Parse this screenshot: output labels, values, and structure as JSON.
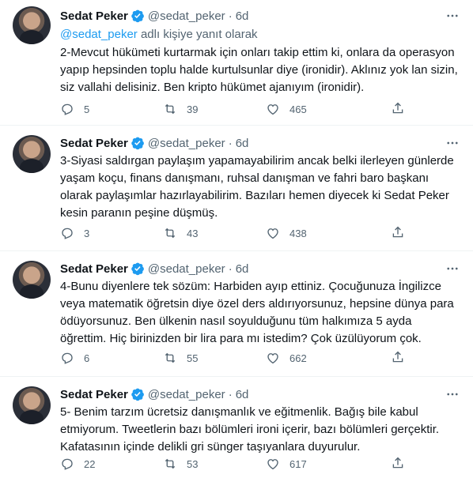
{
  "tweets": [
    {
      "name": "Sedat Peker",
      "handle": "@sedat_peker",
      "time": "6d",
      "reply_mention": "@sedat_peker",
      "reply_suffix": " adlı kişiye yanıt olarak",
      "text": "2-Mevcut hükümeti kurtarmak için onları takip ettim ki, onlara da operasyon yapıp hepsinden toplu halde kurtulsunlar diye (ironidir). Aklınız yok lan sizin, siz vallahi delisiniz. Ben kripto hükümet ajanıyım (ironidir).",
      "replies": "5",
      "retweets": "39",
      "likes": "465"
    },
    {
      "name": "Sedat Peker",
      "handle": "@sedat_peker",
      "time": "6d",
      "text": "3-Siyasi saldırgan paylaşım yapamayabilirim ancak belki ilerleyen günlerde yaşam koçu, finans danışmanı, ruhsal danışman ve fahri baro başkanı olarak paylaşımlar hazırlayabilirim. Bazıları hemen diyecek ki Sedat Peker kesin paranın peşine düşmüş.",
      "replies": "3",
      "retweets": "43",
      "likes": "438"
    },
    {
      "name": "Sedat Peker",
      "handle": "@sedat_peker",
      "time": "6d",
      "text": "4-Bunu diyenlere tek sözüm: Harbiden ayıp ettiniz. Çocuğunuza İngilizce veya matematik öğretsin diye özel ders aldırıyorsunuz, hepsine dünya para ödüyorsunuz. Ben ülkenin nasıl soyulduğunu tüm halkımıza 5 ayda öğrettim. Hiç birinizden bir lira para mı istedim? Çok üzülüyorum çok.",
      "replies": "6",
      "retweets": "55",
      "likes": "662"
    },
    {
      "name": "Sedat Peker",
      "handle": "@sedat_peker",
      "time": "6d",
      "text": "5- Benim tarzım ücretsiz danışmanlık ve eğitmenlik. Bağış bile kabul etmiyorum. Tweetlerin bazı bölümleri ironi içerir, bazı bölümleri gerçektir. Kafatasının içinde delikli gri sünger taşıyanlara duyurulur.",
      "replies": "22",
      "retweets": "53",
      "likes": "617"
    }
  ],
  "separator_dot": "·",
  "colors": {
    "verified": "#1d9bf0",
    "secondary": "#536471",
    "link": "#1d9bf0",
    "text": "#0f1419"
  },
  "icons": [
    "verified-badge-icon",
    "more-icon",
    "reply-icon",
    "retweet-icon",
    "like-icon",
    "share-icon"
  ]
}
